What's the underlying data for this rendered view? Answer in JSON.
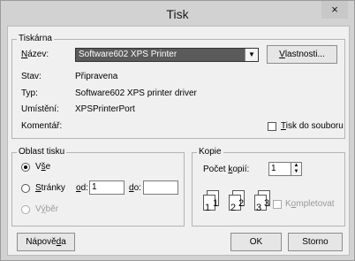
{
  "window": {
    "title": "Tisk",
    "close_glyph": "×"
  },
  "printer": {
    "legend": "Tiskárna",
    "name_label": "Název:",
    "name_value": "Software602 XPS Printer",
    "properties_button": "Vlastnosti...",
    "status_label": "Stav:",
    "status_value": "Připravena",
    "type_label": "Typ:",
    "type_value": "Software602 XPS printer driver",
    "location_label": "Umístění:",
    "location_value": "XPSPrinterPort",
    "comment_label": "Komentář:",
    "print_to_file_label": "Tisk do souboru",
    "print_to_file_checked": false
  },
  "range": {
    "legend": "Oblast tisku",
    "all_label": "Vše",
    "pages_label": "Stránky",
    "from_label": "od:",
    "from_value": "1",
    "to_label": "do:",
    "to_value": "",
    "selection_label": "Výběr",
    "selected": "all"
  },
  "copies": {
    "legend": "Kopie",
    "count_label": "Počet kopií:",
    "count_value": "1",
    "collate_label": "Kompletovat",
    "collate_checked": false,
    "page_numbers": [
      "1",
      "1",
      "2",
      "2",
      "3",
      "3"
    ]
  },
  "buttons": {
    "help": "Nápověda",
    "ok": "OK",
    "cancel": "Storno"
  },
  "icons": {
    "dropdown": "▼",
    "spin_up": "▲",
    "spin_down": "▼"
  }
}
